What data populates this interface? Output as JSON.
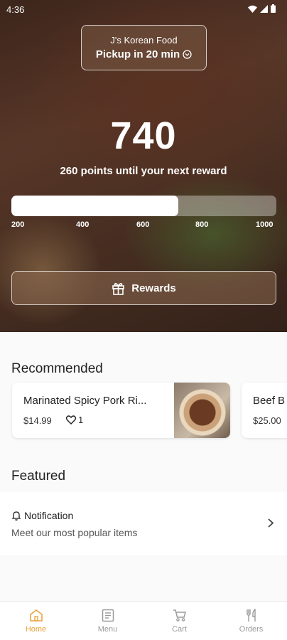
{
  "status_bar": {
    "time": "4:36"
  },
  "store": {
    "name": "J's Korean Food",
    "pickup": "Pickup in 20 min"
  },
  "rewards": {
    "points": "740",
    "subtitle": "260 points until your next reward",
    "progress_fraction": 0.63,
    "ticks": [
      "200",
      "400",
      "600",
      "800",
      "1000"
    ],
    "button_label": "Rewards"
  },
  "recommended": {
    "title": "Recommended",
    "items": [
      {
        "name": "Marinated Spicy Pork Ri...",
        "price": "$14.99",
        "likes": "1"
      },
      {
        "name": "Beef B",
        "price": "$25.00"
      }
    ]
  },
  "featured": {
    "title": "Featured",
    "notification_title": "Notification",
    "notification_text": "Meet our most popular items"
  },
  "nav": {
    "items": [
      {
        "label": "Home",
        "icon": "home-icon",
        "active": true
      },
      {
        "label": "Menu",
        "icon": "menu-icon"
      },
      {
        "label": "Cart",
        "icon": "cart-icon"
      },
      {
        "label": "Orders",
        "icon": "orders-icon"
      }
    ]
  },
  "colors": {
    "accent": "#e8a33c"
  }
}
